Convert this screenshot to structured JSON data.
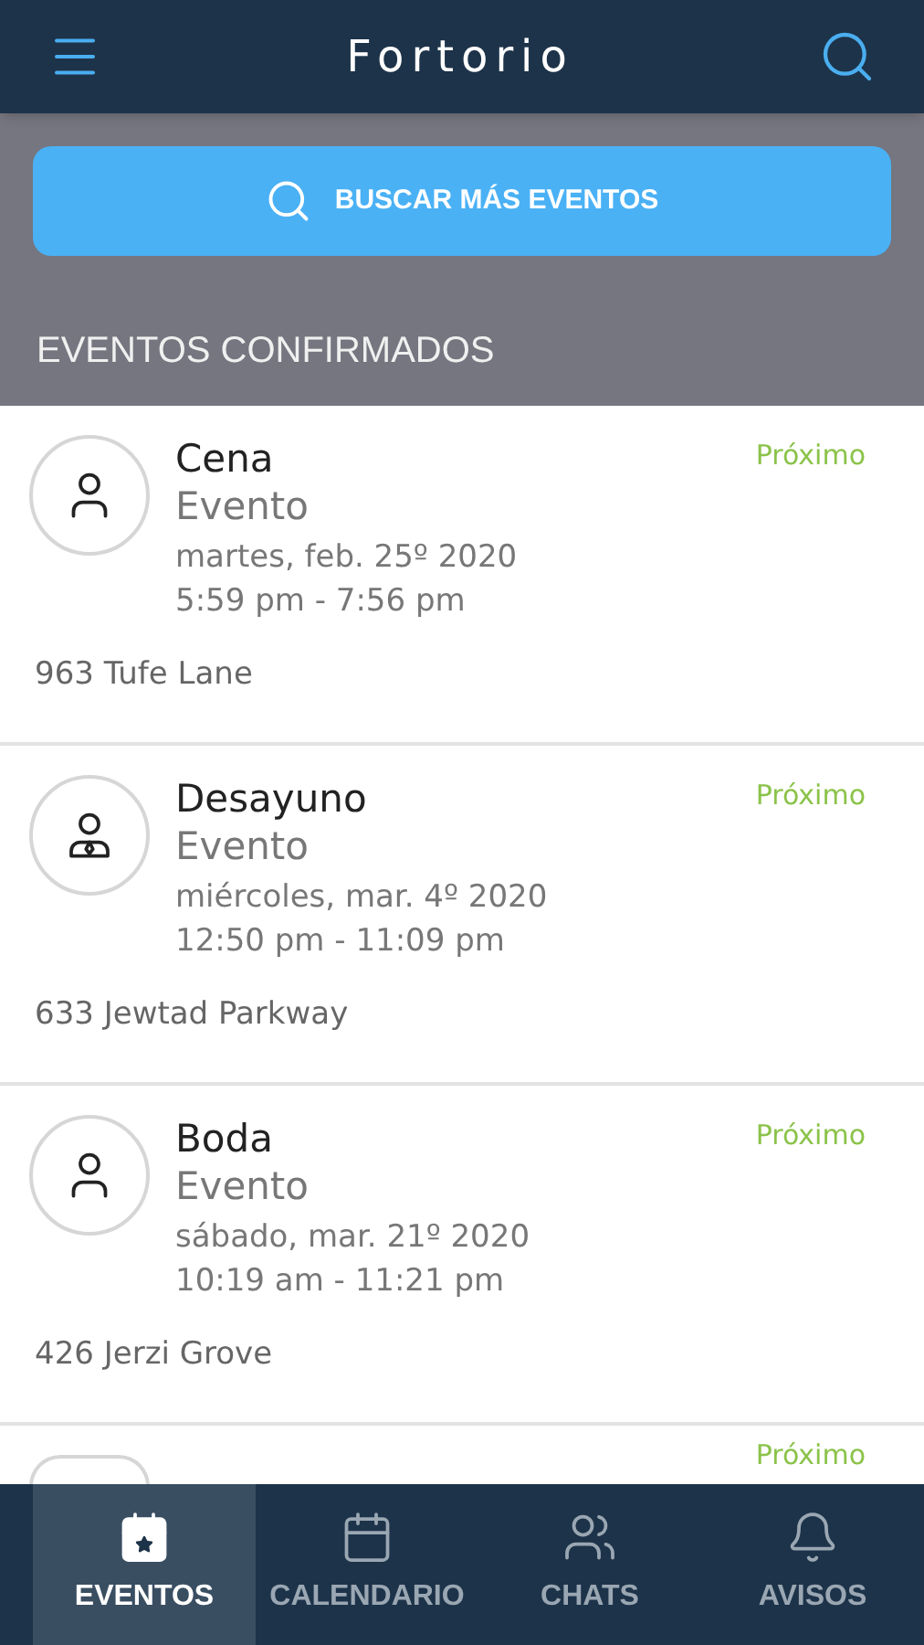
{
  "header": {
    "title": "Fortorio"
  },
  "search_button": {
    "label": "BUSCAR MÁS EVENTOS"
  },
  "section_title": "EVENTOS CONFIRMADOS",
  "events": [
    {
      "kind": "person",
      "name": "Cena",
      "type": "Evento",
      "date": "martes, feb. 25º 2020",
      "time": "5:59 pm - 7:56 pm",
      "address": "963 Tufe Lane",
      "status": "Próximo"
    },
    {
      "kind": "businessperson",
      "name": "Desayuno",
      "type": "Evento",
      "date": "miércoles, mar. 4º 2020",
      "time": "12:50 pm - 11:09 pm",
      "address": "633 Jewtad Parkway",
      "status": "Próximo"
    },
    {
      "kind": "person",
      "name": "Boda",
      "type": "Evento",
      "date": "sábado, mar. 21º 2020",
      "time": "10:19 am - 11:21 pm",
      "address": "426 Jerzi Grove",
      "status": "Próximo"
    },
    {
      "kind": "partial",
      "status": "Próximo"
    }
  ],
  "nav": [
    {
      "kind": "events",
      "label": "EVENTOS",
      "selected": true
    },
    {
      "kind": "calendar",
      "label": "CALENDARIO",
      "selected": false
    },
    {
      "kind": "chats",
      "label": "CHATS",
      "selected": false
    },
    {
      "kind": "alerts",
      "label": "AVISOS",
      "selected": false
    }
  ]
}
